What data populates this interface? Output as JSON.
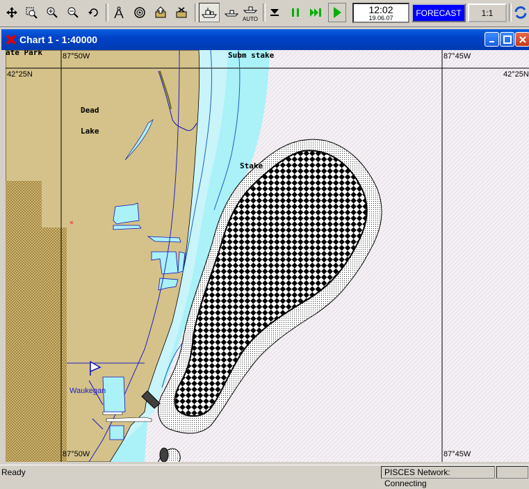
{
  "toolbar": {
    "buttons": [
      {
        "icon": "move-arrows-icon"
      },
      {
        "icon": "zoom-window-icon"
      },
      {
        "icon": "zoom-in-icon"
      },
      {
        "icon": "zoom-out-icon"
      },
      {
        "icon": "undo-icon"
      },
      {
        "icon": "compass-icon"
      },
      {
        "icon": "target-icon"
      },
      {
        "icon": "upload-icon"
      },
      {
        "icon": "cargo-icon"
      },
      {
        "icon": "ship-icon"
      },
      {
        "icon": "ship-small-icon"
      },
      {
        "icon": "auto-ship-icon"
      },
      {
        "icon": "stop-icon"
      },
      {
        "icon": "pause-icon"
      },
      {
        "icon": "fast-forward-icon"
      },
      {
        "icon": "play-icon"
      }
    ],
    "auto_label": "AUTO",
    "clock_time": "12:02",
    "clock_date": "19.06.07",
    "forecast_label": "FORECAST",
    "scale_label": "1:1"
  },
  "window": {
    "title": "Chart 1 - 1:40000"
  },
  "chart": {
    "coords": {
      "top_left_lon": "87°50W",
      "top_right_lon": "87°45W",
      "bottom_left_lon": "87°50W",
      "bottom_right_lon": "87°45W",
      "left_lat": "42°25N",
      "right_lat": "42°25N"
    },
    "labels": {
      "park": "ate Park",
      "subm_stake": "Subm stake",
      "dead": "Dead",
      "lake": "Lake",
      "stake": "Stake",
      "waukegan": "Waukegan"
    },
    "colors": {
      "land": "#d4c28a",
      "shallow_water": "#aaf1f8",
      "deep_water": "#f4f0f4",
      "park_area": "#c89c3c",
      "waukegan_blue": "#2020c0"
    }
  },
  "status": {
    "ready": "Ready",
    "network": "PISCES Network: Connecting"
  }
}
